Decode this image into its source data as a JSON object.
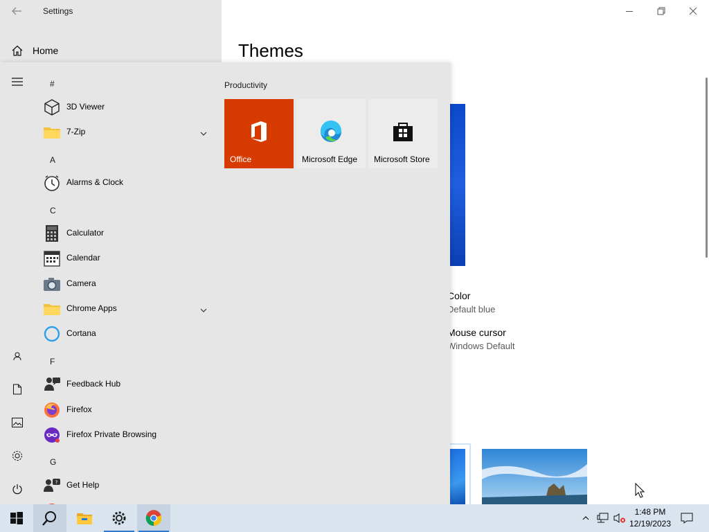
{
  "window": {
    "title": "Settings",
    "home_label": "Home",
    "page_title": "Themes",
    "settings_items": [
      {
        "name": "Color",
        "value": "Default blue"
      },
      {
        "name": "Mouse cursor",
        "value": "Windows Default"
      }
    ]
  },
  "start_menu": {
    "app_list": [
      {
        "type": "letter",
        "text": "#"
      },
      {
        "type": "app",
        "label": "3D Viewer",
        "icon": "cube-icon"
      },
      {
        "type": "app",
        "label": "7-Zip",
        "icon": "folder-icon",
        "expandable": true
      },
      {
        "type": "letter",
        "text": "A"
      },
      {
        "type": "app",
        "label": "Alarms & Clock",
        "icon": "clock-icon"
      },
      {
        "type": "letter",
        "text": "C"
      },
      {
        "type": "app",
        "label": "Calculator",
        "icon": "calculator-icon"
      },
      {
        "type": "app",
        "label": "Calendar",
        "icon": "calendar-icon"
      },
      {
        "type": "app",
        "label": "Camera",
        "icon": "camera-icon"
      },
      {
        "type": "app",
        "label": "Chrome Apps",
        "icon": "folder-icon",
        "expandable": true
      },
      {
        "type": "app",
        "label": "Cortana",
        "icon": "cortana-icon"
      },
      {
        "type": "letter",
        "text": "F"
      },
      {
        "type": "app",
        "label": "Feedback Hub",
        "icon": "feedback-icon"
      },
      {
        "type": "app",
        "label": "Firefox",
        "icon": "firefox-icon"
      },
      {
        "type": "app",
        "label": "Firefox Private Browsing",
        "icon": "firefox-private-icon"
      },
      {
        "type": "letter",
        "text": "G"
      },
      {
        "type": "app",
        "label": "Get Help",
        "icon": "get-help-icon"
      }
    ],
    "tile_group": "Productivity",
    "tiles": [
      {
        "label": "Office",
        "icon": "office-icon",
        "bg": "#d83b01",
        "fg": "#ffffff"
      },
      {
        "label": "Microsoft Edge",
        "icon": "edge-icon",
        "bg": "#ececec",
        "fg": "#000000"
      },
      {
        "label": "Microsoft Store",
        "icon": "store-icon",
        "bg": "#ececec",
        "fg": "#000000"
      }
    ]
  },
  "taskbar": {
    "time": "1:48 PM",
    "date": "12/19/2023"
  },
  "colors": {
    "accent": "#2e7ad1",
    "office_tile": "#d83b01",
    "start_bg": "#e6e6e6",
    "taskbar_bg": "#d9e4ef"
  }
}
